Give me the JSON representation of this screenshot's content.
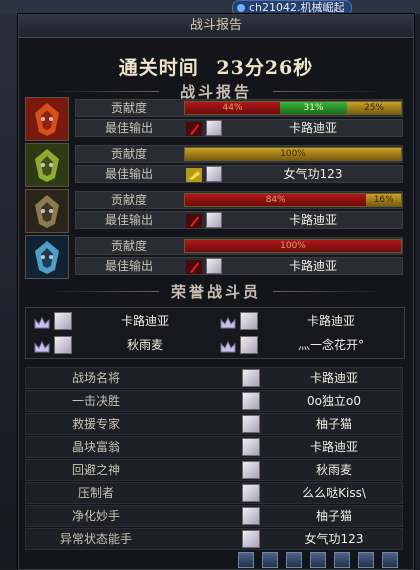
{
  "chat": {
    "text": "ch21042.机械崛起"
  },
  "panel": {
    "title": "战斗报告"
  },
  "clear_time": {
    "label": "通关时间",
    "value": "23分26秒"
  },
  "report": {
    "title": "战斗报告",
    "contribution_label": "贡献度",
    "best_output_label": "最佳输出",
    "bosses": [
      {
        "name_icon": "boss-fire-icon",
        "contribution": [
          {
            "pct": 44,
            "text": "44%",
            "color": "red"
          },
          {
            "pct": 31,
            "text": "31%",
            "color": "green"
          },
          {
            "pct": 25,
            "text": "25%",
            "color": "gold"
          }
        ],
        "best_output_name": "卡路迪亚",
        "weapon_icon": "red-sword-icon"
      },
      {
        "name_icon": "boss-green-icon",
        "contribution": [
          {
            "pct": 100,
            "text": "100%",
            "color": "gold"
          }
        ],
        "best_output_name": "女气功123",
        "weapon_icon": "gold-gauntlet-icon"
      },
      {
        "name_icon": "boss-dark-icon",
        "contribution": [
          {
            "pct": 84,
            "text": "84%",
            "color": "red"
          },
          {
            "pct": 16,
            "text": "16%",
            "color": "gold"
          }
        ],
        "best_output_name": "卡路迪亚",
        "weapon_icon": "red-sword-icon"
      },
      {
        "name_icon": "boss-ice-icon",
        "contribution": [
          {
            "pct": 100,
            "text": "100%",
            "color": "red"
          }
        ],
        "best_output_name": "卡路迪亚",
        "weapon_icon": "red-sword-icon"
      }
    ]
  },
  "honor": {
    "title": "荣誉战斗员",
    "members": [
      {
        "name": "卡路迪亚"
      },
      {
        "name": "卡路迪亚"
      },
      {
        "name": "秋雨麦"
      },
      {
        "name": "灬一念花开°"
      }
    ]
  },
  "awards": [
    {
      "title": "战场名将",
      "player": "卡路迪亚"
    },
    {
      "title": "一击决胜",
      "player": "0o独立o0"
    },
    {
      "title": "救援专家",
      "player": "柚子猫"
    },
    {
      "title": "晶块富翁",
      "player": "卡路迪亚"
    },
    {
      "title": "回避之神",
      "player": "秋雨麦"
    },
    {
      "title": "压制者",
      "player": "么么哒Kiss\\"
    },
    {
      "title": "净化妙手",
      "player": "柚子猫"
    },
    {
      "title": "异常状态能手",
      "player": "女气功123"
    }
  ]
}
